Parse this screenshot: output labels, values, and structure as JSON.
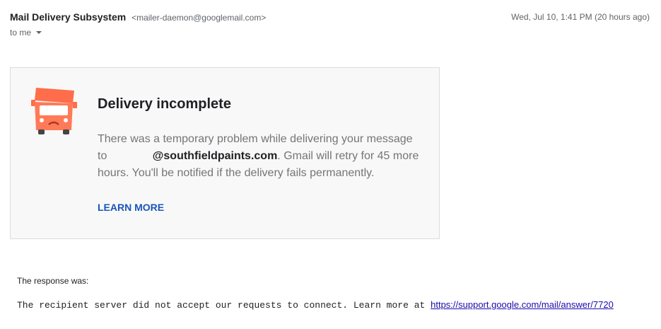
{
  "message": {
    "sender_name": "Mail Delivery Subsystem",
    "sender_email": "<mailer-daemon@googlemail.com>",
    "date": "Wed, Jul 10, 1:41 PM (20 hours ago)",
    "recipient_label": "to me"
  },
  "card": {
    "icon": "delivery-truck-icon",
    "title": "Delivery incomplete",
    "body_prefix": "There was a temporary problem while delivering your message to ",
    "domain": "@southfieldpaints.com",
    "body_suffix": ". Gmail will retry for 45 more hours. You'll be notified if the delivery fails permanently.",
    "learn_more": "LEARN MORE"
  },
  "response": {
    "label": "The response was:",
    "text": "The recipient server did not accept our requests to connect. Learn more at ",
    "link": "https://support.google.com/mail/answer/7720"
  },
  "colors": {
    "truck": "#ff6d4a",
    "link": "#1a56b7"
  }
}
